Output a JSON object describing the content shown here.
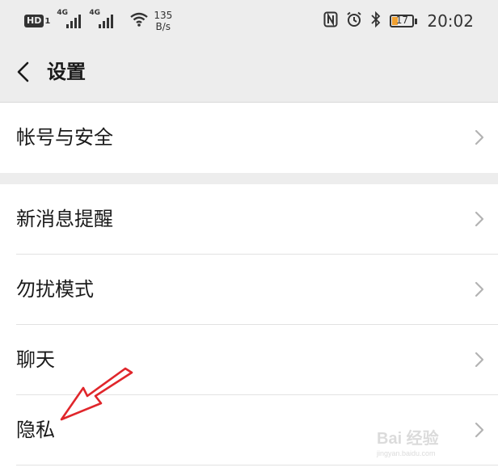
{
  "status_bar": {
    "hd_label": "HD",
    "hd_sub": "1",
    "signal1_tag": "4G",
    "signal2_tag": "4G",
    "net_speed_value": "135",
    "net_speed_unit": "B/s",
    "battery_level": "17",
    "time": "20:02",
    "icons": [
      "nfc-icon",
      "alarm-icon",
      "bluetooth-icon"
    ],
    "battery_color": "#f0a030"
  },
  "header": {
    "title": "设置"
  },
  "groups": [
    {
      "items": [
        {
          "label": "帐号与安全"
        }
      ]
    },
    {
      "items": [
        {
          "label": "新消息提醒"
        },
        {
          "label": "勿扰模式"
        },
        {
          "label": "聊天"
        },
        {
          "label": "隐私"
        }
      ]
    }
  ],
  "annotation_arrow_color": "#e0262b",
  "watermark": {
    "brand": "Bai 经验",
    "url": "jingyan.baidu.com"
  }
}
